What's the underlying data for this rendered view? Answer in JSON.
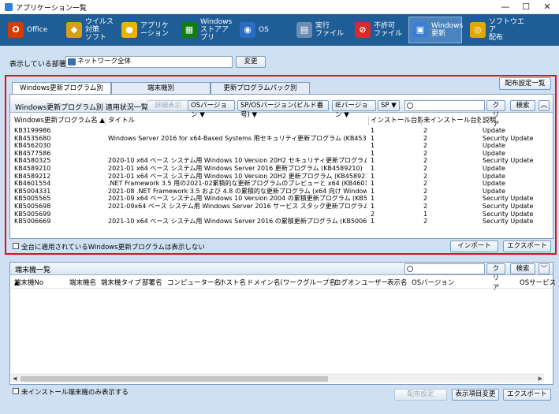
{
  "window": {
    "title": "アプリケーション一覧",
    "minimize_glyph": "—",
    "maximize_glyph": "☐",
    "close_glyph": "✕"
  },
  "toolbar": [
    {
      "label": "Office",
      "icon": "office-icon",
      "color": "#d83b01",
      "glyph": "O"
    },
    {
      "label": "ウイルス対策\nソフト",
      "icon": "antivirus-icon",
      "color": "#d4a017",
      "glyph": "◆"
    },
    {
      "label": "アプリケーション",
      "icon": "application-icon",
      "color": "#e8b400",
      "glyph": "●"
    },
    {
      "label": "Windows\nストアアプリ",
      "icon": "store-icon",
      "color": "#107c10",
      "glyph": "▦"
    },
    {
      "label": "OS",
      "icon": "os-icon",
      "color": "#2b6cc4",
      "glyph": "◉"
    },
    {
      "label": "実行\nファイル",
      "icon": "executable-icon",
      "color": "#6e8db3",
      "glyph": "▤"
    },
    {
      "label": "不許可\nファイル",
      "icon": "forbidden-icon",
      "color": "#d52b2b",
      "glyph": "⊘"
    },
    {
      "label": "Windows\n更新",
      "icon": "windows-update-icon",
      "color": "#3a7fd1",
      "glyph": "▣",
      "active": true
    },
    {
      "label": "ソフトウエア\n配布",
      "icon": "software-distribution-icon",
      "color": "#e0a800",
      "glyph": "◎"
    }
  ],
  "dept": {
    "label": "表示している部署:",
    "value": "ネットワーク全体",
    "change_button": "変更"
  },
  "tabs": [
    "Windows更新プログラム別",
    "端末機別",
    "更新プログラムパック別"
  ],
  "dist_settings_list": "配布設定一覧",
  "panel": {
    "title": "Windows更新プログラム別 適用状況一覧",
    "detail_button": "詳細表示",
    "filters": [
      "OSバージョン",
      "SP/OSバージョン(ビルド番号)",
      "IEバージョン",
      "SP"
    ],
    "clear_button": "クリア",
    "search_button": "検索",
    "columns": [
      "Windows更新プログラム名",
      "タイトル",
      "インストール台数",
      "未インストール台数",
      "説明"
    ],
    "rows": [
      [
        "KB3199986",
        "",
        "1",
        "2",
        "Update"
      ],
      [
        "KB4535680",
        "Windows Server 2016 for x64-Based Systems 用セキュリティ更新プログラム (KB4535680)",
        "1",
        "2",
        "Security Update"
      ],
      [
        "KB4562030",
        "",
        "1",
        "2",
        "Update"
      ],
      [
        "KB4577586",
        "",
        "1",
        "2",
        "Update"
      ],
      [
        "KB4580325",
        "2020-10 x64 ベース システム用 Windows 10 Version 20H2 セキュリティ更新プログラム (A…",
        "1",
        "2",
        "Security Update"
      ],
      [
        "KB4589210",
        "2021-01 x64 ベース システム用 Windows Server 2016 更新プログラム (KB4589210)",
        "1",
        "2",
        "Update"
      ],
      [
        "KB4589212",
        "2021-01 x64 ベース システム用 Windows 10 Version 20H2 更新プログラム (KB4589212)",
        "1",
        "2",
        "Update"
      ],
      [
        "KB4601554",
        ".NET Framework 3.5 用の2021-02累積的な更新プログラムのプレビューと x64 (KB4601554…",
        "1",
        "2",
        "Update"
      ],
      [
        "KB5004331",
        "2021-08 .NET Framework 3.5 および 4.8 の累積的な更新プログラム (x64 向け Windows 1…",
        "1",
        "2",
        "Update"
      ],
      [
        "KB5005565",
        "2021-09 x64 ベース システム用 Windows 10 Version 2004 の累積更新プログラム (KB500…",
        "1",
        "2",
        "Security Update"
      ],
      [
        "KB5005698",
        "2021-09x64 ベース システム用 Windows Server 2016 サービス スタック更新プログラム (KB…",
        "1",
        "2",
        "Security Update"
      ],
      [
        "KB5005699",
        "",
        "2",
        "1",
        "Security Update"
      ],
      [
        "KB5006669",
        "2021-10 x64 ベース システム用 Windows Server 2016 の累積更新プログラム (KB5006669)",
        "1",
        "2",
        "Security Update"
      ]
    ],
    "hide_checkbox_label": "全台に適用されているWindows更新プログラムは表示しない",
    "import_button": "インポート",
    "export_button": "エクスポート"
  },
  "terminal": {
    "title": "端末機一覧",
    "clear_button": "クリア",
    "search_button": "検索",
    "columns": [
      "端末機No",
      "端末機名",
      "端末機タイプ",
      "部署名",
      "コンピューター名",
      "ホスト名",
      "ドメイン名(ワークグループ名)",
      "ログオンユーザー",
      "表示名",
      "OSバージョン",
      "OSサービス"
    ],
    "uninstalled_only_label": "未インストール端末機のみ表示する",
    "dist_settings_button": "配布設定",
    "display_items_button": "表示項目変更",
    "export_button": "エクスポート"
  }
}
